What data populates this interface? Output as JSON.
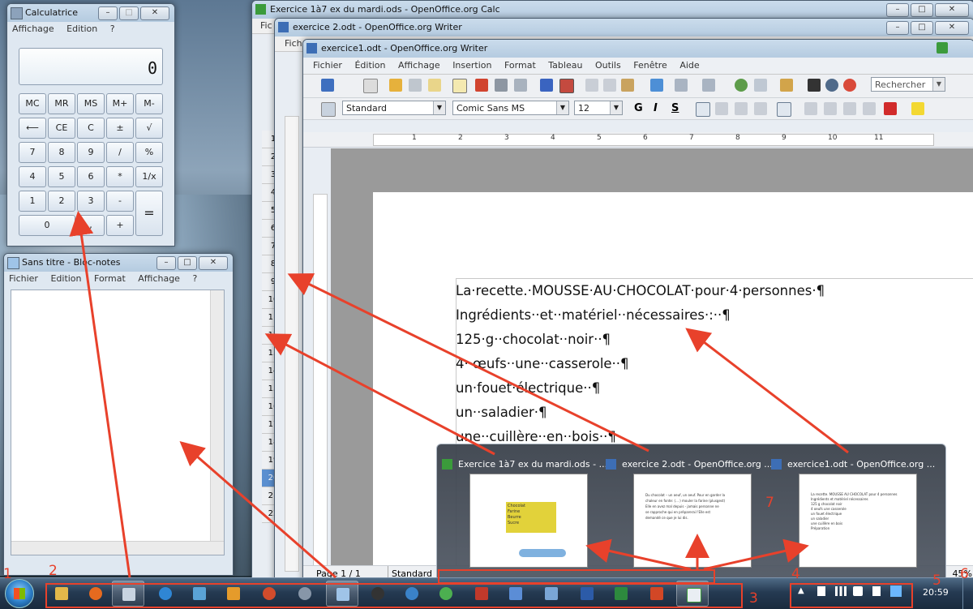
{
  "calculator": {
    "title": "Calculatrice",
    "menu": [
      "Affichage",
      "Edition",
      "?"
    ],
    "display": "0",
    "buttons": [
      "MC",
      "MR",
      "MS",
      "M+",
      "M-",
      "⟵",
      "CE",
      "C",
      "±",
      "√",
      "7",
      "8",
      "9",
      "/",
      "%",
      "4",
      "5",
      "6",
      "*",
      "1/x",
      "1",
      "2",
      "3",
      "-",
      "=",
      "0",
      ",",
      "+"
    ]
  },
  "notepad": {
    "title": "Sans titre - Bloc-notes",
    "menu": [
      "Fichier",
      "Edition",
      "Format",
      "Affichage",
      "?"
    ]
  },
  "calc_window": {
    "title": "Exercice 1à7 ex du mardi.ods - OpenOffice.org Calc",
    "menu_first": "Fic",
    "row_numbers": [
      "1",
      "2",
      "3",
      "4",
      "5",
      "6",
      "7",
      "8",
      "9",
      "10",
      "11",
      "12",
      "13",
      "14",
      "15",
      "16",
      "17",
      "18",
      "19",
      "20",
      "21",
      "22"
    ]
  },
  "writer2": {
    "title": "exercice 2.odt - OpenOffice.org Writer",
    "menu_first": "Fich"
  },
  "writer1": {
    "title": "exercice1.odt - OpenOffice.org Writer",
    "menu": [
      "Fichier",
      "Édition",
      "Affichage",
      "Insertion",
      "Format",
      "Tableau",
      "Outils",
      "Fenêtre",
      "Aide"
    ],
    "search_placeholder": "Rechercher",
    "paragraph_style": "Standard",
    "font_name": "Comic Sans MS",
    "font_size": "12",
    "bold": "G",
    "italic": "I",
    "underline": "S",
    "ruler_marks": [
      "1",
      "2",
      "3",
      "4",
      "5",
      "6",
      "7",
      "8",
      "9",
      "10",
      "11"
    ],
    "document_lines": [
      "La·recette.·MOUSSE·AU·CHOCOLAT·pour·4·personnes·¶",
      "Ingrédients··et··matériel··nécessaires·:··¶",
      "125·g··chocolat··noir··¶",
      "4··œufs··une··casserole··¶",
      "un·fouet·électrique··¶",
      "un··saladier·¶",
      "une··cuillère··en··bois··¶"
    ],
    "status_page": "Page 1 / 1",
    "status_style": "Standard",
    "zoom": "45%"
  },
  "preview": {
    "items": [
      {
        "caption": "Exercice 1à7 ex du mardi.ods - ..."
      },
      {
        "caption": "exercice 2.odt - OpenOffice.org ..."
      },
      {
        "caption": "exercice1.odt - OpenOffice.org ..."
      }
    ],
    "thumb1_lines": [
      "Chocolat",
      "Farine",
      "Beurre",
      "Sucre"
    ],
    "thumb2_lines": [
      "Du chocolat – un oeuf, un oeuf. Pour en garder la",
      "chaleur en fonte: (... ) mouler la farine (plusgest)",
      "Elle en avez mal depuis - jamais personne ne",
      "se rapproche qui en préparerai l'Elle est",
      "demandé ce que je lui dis."
    ],
    "thumb3_lines": [
      "La recette. MOUSSE AU CHOCOLAT pour 4 personnes",
      "Ingrédients et matériel nécessaires",
      "125 g chocolat noir",
      "4 oeufs une casserole",
      "un fouet électrique",
      "un saladier",
      "une cuillère en bois",
      "Préparation"
    ]
  },
  "taskbar": {
    "clock": "20:59"
  },
  "annotations": [
    "1",
    "2",
    "3",
    "4",
    "5",
    "6",
    "7"
  ],
  "colors": {
    "annotation": "#e8412b",
    "taskbar": "#253a52"
  }
}
